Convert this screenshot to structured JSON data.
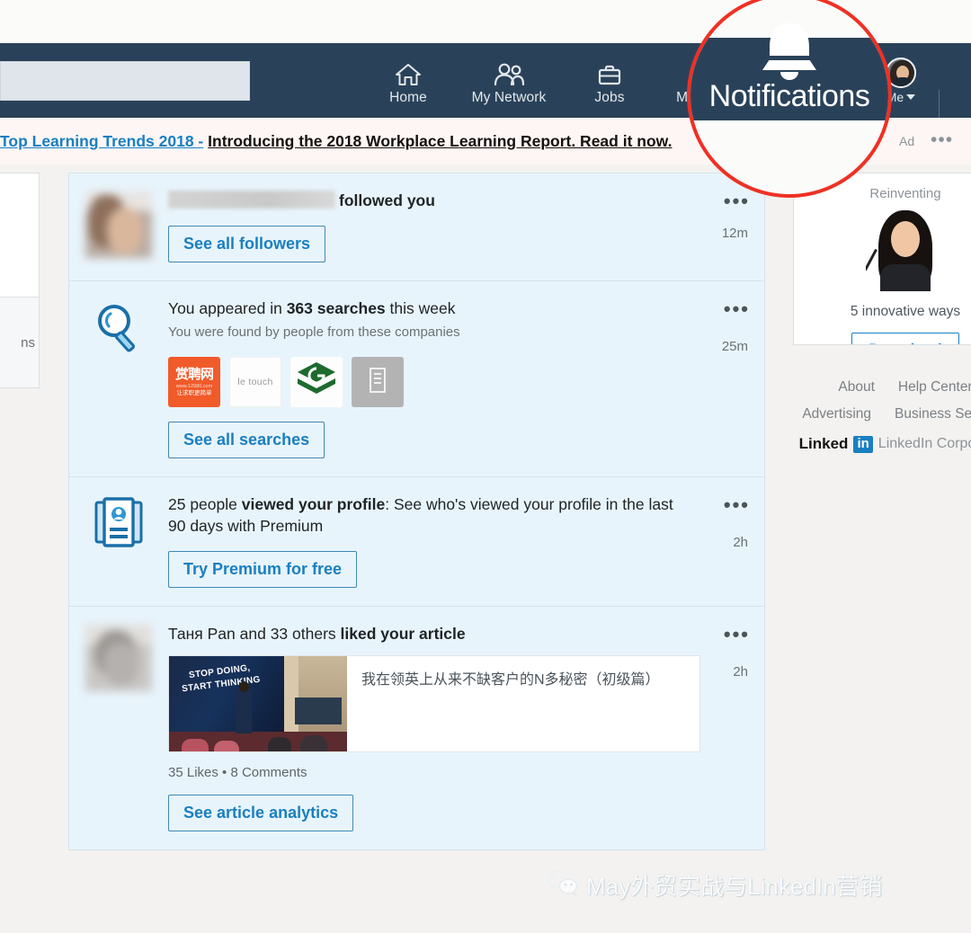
{
  "nav": {
    "search_placeholder": "",
    "search_value": "",
    "items": [
      {
        "label": "Home",
        "icon": "home-icon"
      },
      {
        "label": "My Network",
        "icon": "people-icon"
      },
      {
        "label": "Jobs",
        "icon": "briefcase-icon"
      },
      {
        "label": "Messaging",
        "icon": "message-icon"
      },
      {
        "label": "Notifications",
        "icon": "bell-icon"
      }
    ],
    "me_label": "Me"
  },
  "ad_banner": {
    "link_text": "Top Learning Trends 2018 -",
    "body_text": "Introducing the 2018 Workplace Learning Report. Read it now.",
    "tag": "Ad",
    "overflow_tail": "w.",
    "menu": "•••"
  },
  "left_rail": {
    "clipped_label": "ns"
  },
  "magnifier": {
    "label": "Notifications",
    "icon": "bell-icon",
    "ring_color": "#ee3124"
  },
  "notifications": [
    {
      "id": "followed-you",
      "avatar": "blurred-person-avatar",
      "name_blurred": true,
      "text_bold": "followed you",
      "cta": "See all followers",
      "time": "12m",
      "menu": "•••"
    },
    {
      "id": "search-appearances",
      "icon": "magnifier-icon",
      "text_prefix": "You appeared in ",
      "text_bold": "363 searches",
      "text_suffix": " this week",
      "subtitle": "You were found by people from these companies",
      "companies": [
        {
          "name": "赏聘网",
          "url_line": "www.12980.com",
          "tagline": "让求职更简单",
          "style": "orange"
        },
        {
          "name": "le touch",
          "style": "white"
        },
        {
          "name": "green-stacked-g",
          "style": "green"
        },
        {
          "name": "generic-company",
          "style": "gray"
        }
      ],
      "cta": "See all searches",
      "time": "25m",
      "menu": "•••"
    },
    {
      "id": "profile-views",
      "icon": "profile-card-icon",
      "text_prefix": "25 people ",
      "text_bold": "viewed your profile",
      "text_suffix": ": See who's viewed your profile in the last 90 days with Premium",
      "cta": "Try Premium for free",
      "time": "2h",
      "menu": "•••"
    },
    {
      "id": "article-liked",
      "avatar": "blurred-person-avatar",
      "text_prefix": "Таня Pan and 33 others ",
      "text_bold": "liked your article",
      "article_title": "我在领英上从来不缺客户的N多秘密（初级篇）",
      "thumb_line1": "STOP DOING,",
      "thumb_line2": "START THINKING",
      "stats": "35 Likes  •  8 Comments",
      "cta": "See article analytics",
      "time": "2h",
      "menu": "•••"
    }
  ],
  "right_column": {
    "promo": {
      "kicker": "Reinventing",
      "title": "5 innovative ways",
      "button": "Download"
    },
    "footer_links_row1": [
      "About",
      "Help Center"
    ],
    "footer_links_row2": [
      "Advertising",
      "Business Services"
    ],
    "brand": {
      "word": "Linked",
      "box": "in",
      "corp": "LinkedIn Corporation"
    }
  },
  "watermark": {
    "icon": "wechat-icon",
    "text": "May外贸实战与LinkedIn营销"
  }
}
